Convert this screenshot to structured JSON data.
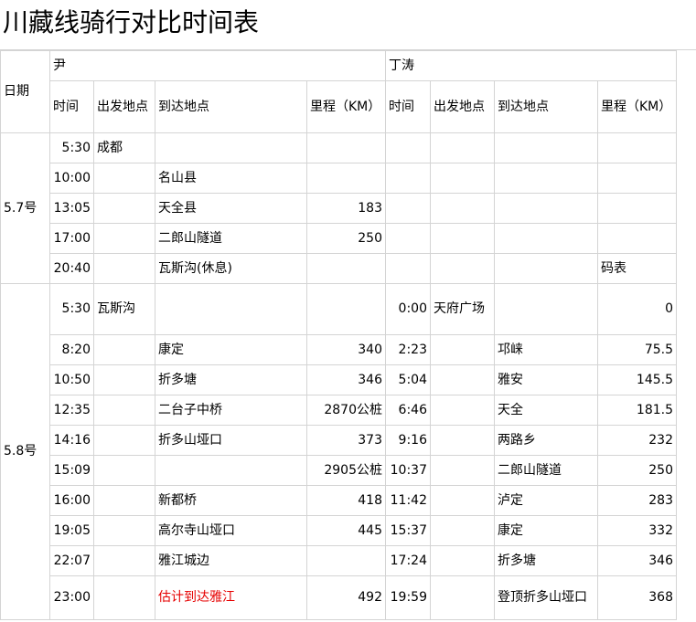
{
  "title": "川藏线骑行对比时间表",
  "header": {
    "date_label": "日期",
    "rider1": "尹",
    "rider2": "丁涛",
    "col_time": "时间",
    "col_origin": "出发地点",
    "col_dest": "到达地点",
    "col_dist": "里程（KM）"
  },
  "day1": {
    "label": "5.7号",
    "rows": [
      {
        "t1": "5:30",
        "o1": "成都",
        "d1": "",
        "k1": "",
        "t2": "",
        "o2": "",
        "d2": "",
        "k2": ""
      },
      {
        "t1": "10:00",
        "o1": "",
        "d1": "名山县",
        "k1": "",
        "t2": "",
        "o2": "",
        "d2": "",
        "k2": ""
      },
      {
        "t1": "13:05",
        "o1": "",
        "d1": "天全县",
        "k1": "183",
        "t2": "",
        "o2": "",
        "d2": "",
        "k2": ""
      },
      {
        "t1": "17:00",
        "o1": "",
        "d1": "二郎山隧道",
        "k1": "250",
        "t2": "",
        "o2": "",
        "d2": "",
        "k2": ""
      },
      {
        "t1": "20:40",
        "o1": "",
        "d1": "瓦斯沟(休息)",
        "k1": "",
        "t2": "",
        "o2": "",
        "d2": "",
        "k2": "码表"
      }
    ]
  },
  "day2": {
    "label": "5.8号",
    "rows": [
      {
        "t1": "5:30",
        "o1": "瓦斯沟",
        "d1": "",
        "k1": "",
        "t2": "0:00",
        "o2": "天府广场",
        "d2": "",
        "k2": "0"
      },
      {
        "t1": "8:20",
        "o1": "",
        "d1": "康定",
        "k1": "340",
        "t2": "2:23",
        "o2": "",
        "d2": "邛崃",
        "k2": "75.5"
      },
      {
        "t1": "10:50",
        "o1": "",
        "d1": "折多塘",
        "k1": "346",
        "t2": "5:04",
        "o2": "",
        "d2": "雅安",
        "k2": "145.5"
      },
      {
        "t1": "12:35",
        "o1": "",
        "d1": "二台子中桥",
        "k1": "2870公桩",
        "t2": "6:46",
        "o2": "",
        "d2": "天全",
        "k2": "181.5"
      },
      {
        "t1": "14:16",
        "o1": "",
        "d1": "折多山垭口",
        "k1": "373",
        "t2": "9:16",
        "o2": "",
        "d2": "两路乡",
        "k2": "232"
      },
      {
        "t1": "15:09",
        "o1": "",
        "d1": "",
        "k1": "2905公桩",
        "t2": "10:37",
        "o2": "",
        "d2": "二郎山隧道",
        "k2": "250"
      },
      {
        "t1": "16:00",
        "o1": "",
        "d1": "新都桥",
        "k1": "418",
        "t2": "11:42",
        "o2": "",
        "d2": "泸定",
        "k2": "283"
      },
      {
        "t1": "19:05",
        "o1": "",
        "d1": "高尔寺山垭口",
        "k1": "445",
        "t2": "15:37",
        "o2": "",
        "d2": "康定",
        "k2": "332"
      },
      {
        "t1": "22:07",
        "o1": "",
        "d1": "雅江城边",
        "k1": "",
        "t2": "17:24",
        "o2": "",
        "d2": "折多塘",
        "k2": "346"
      },
      {
        "t1": "23:00",
        "o1": "",
        "d1": "估计到达雅江",
        "k1": "492",
        "t2": "19:59",
        "o2": "",
        "d2": "登顶折多山垭口",
        "k2": "368"
      }
    ]
  },
  "colors": {
    "grid": "#d4d4d4",
    "highlight_text": "#e60000"
  }
}
